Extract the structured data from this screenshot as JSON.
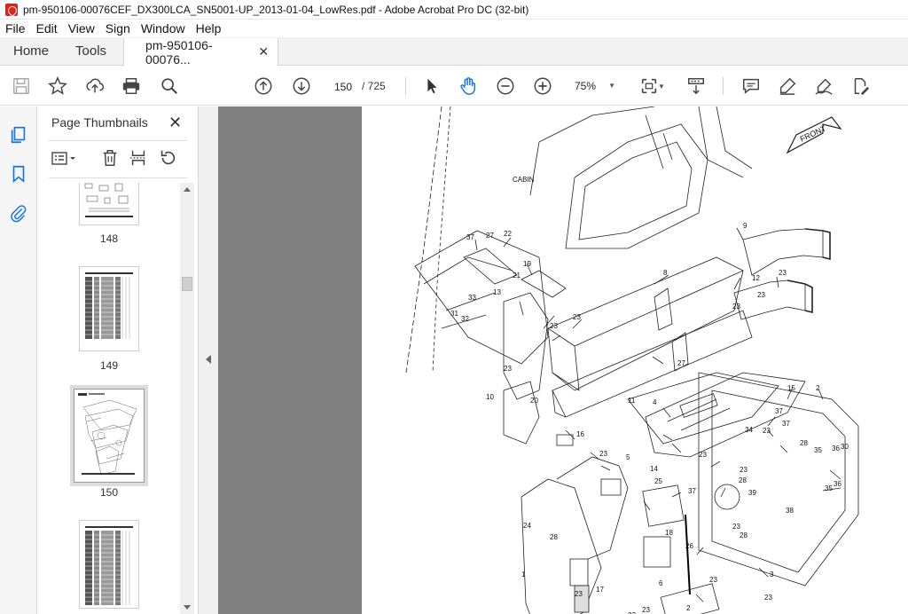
{
  "window": {
    "title": "pm-950106-00076CEF_DX300LCA_SN5001-UP_2013-01-04_LowRes.pdf - Adobe Acrobat Pro DC (32-bit)"
  },
  "menu": [
    "File",
    "Edit",
    "View",
    "Sign",
    "Window",
    "Help"
  ],
  "tabs": {
    "home": "Home",
    "tools": "Tools",
    "document": "pm-950106-00076...",
    "close": "✕"
  },
  "toolbar": {
    "current_page": "150",
    "total_pages": "/ 725",
    "zoom": "75%",
    "icons": [
      "save-icon",
      "bookmark-star-icon",
      "upload-icon",
      "print-icon",
      "search-icon",
      "prev-page-icon",
      "next-page-icon",
      "select-cursor-icon",
      "hand-pan-icon",
      "zoom-out-icon",
      "zoom-in-icon",
      "fit-page-icon",
      "scroll-mode-icon",
      "comment-icon",
      "highlight-icon",
      "sign-icon",
      "fill-sign-icon"
    ]
  },
  "sidebar": {
    "title": "Page Thumbnails",
    "close": "✕",
    "thumbnails": [
      {
        "label": "148"
      },
      {
        "label": "149"
      },
      {
        "label": "150",
        "selected": true
      },
      {
        "label": ""
      }
    ]
  },
  "drawing": {
    "labels": {
      "cabin": "CABIN",
      "front": "FRONT"
    },
    "callouts": [
      "37",
      "27",
      "22",
      "19",
      "33",
      "13",
      "21",
      "31",
      "32",
      "23",
      "23",
      "23",
      "8",
      "9",
      "12",
      "23",
      "23",
      "23",
      "11",
      "10",
      "20",
      "16",
      "4",
      "27",
      "15",
      "2",
      "37",
      "34",
      "37",
      "23",
      "28",
      "35",
      "36",
      "30",
      "23",
      "23",
      "28",
      "39",
      "14",
      "25",
      "5",
      "23",
      "24",
      "37",
      "18",
      "26",
      "6",
      "35",
      "36",
      "38",
      "23",
      "28",
      "3",
      "1",
      "23",
      "17",
      "23",
      "23",
      "2",
      "23",
      "28",
      "23"
    ]
  },
  "colors": {
    "accent_red": "#d9261c",
    "doc_bg": "#808080",
    "selection_blue": "#1473e6"
  }
}
